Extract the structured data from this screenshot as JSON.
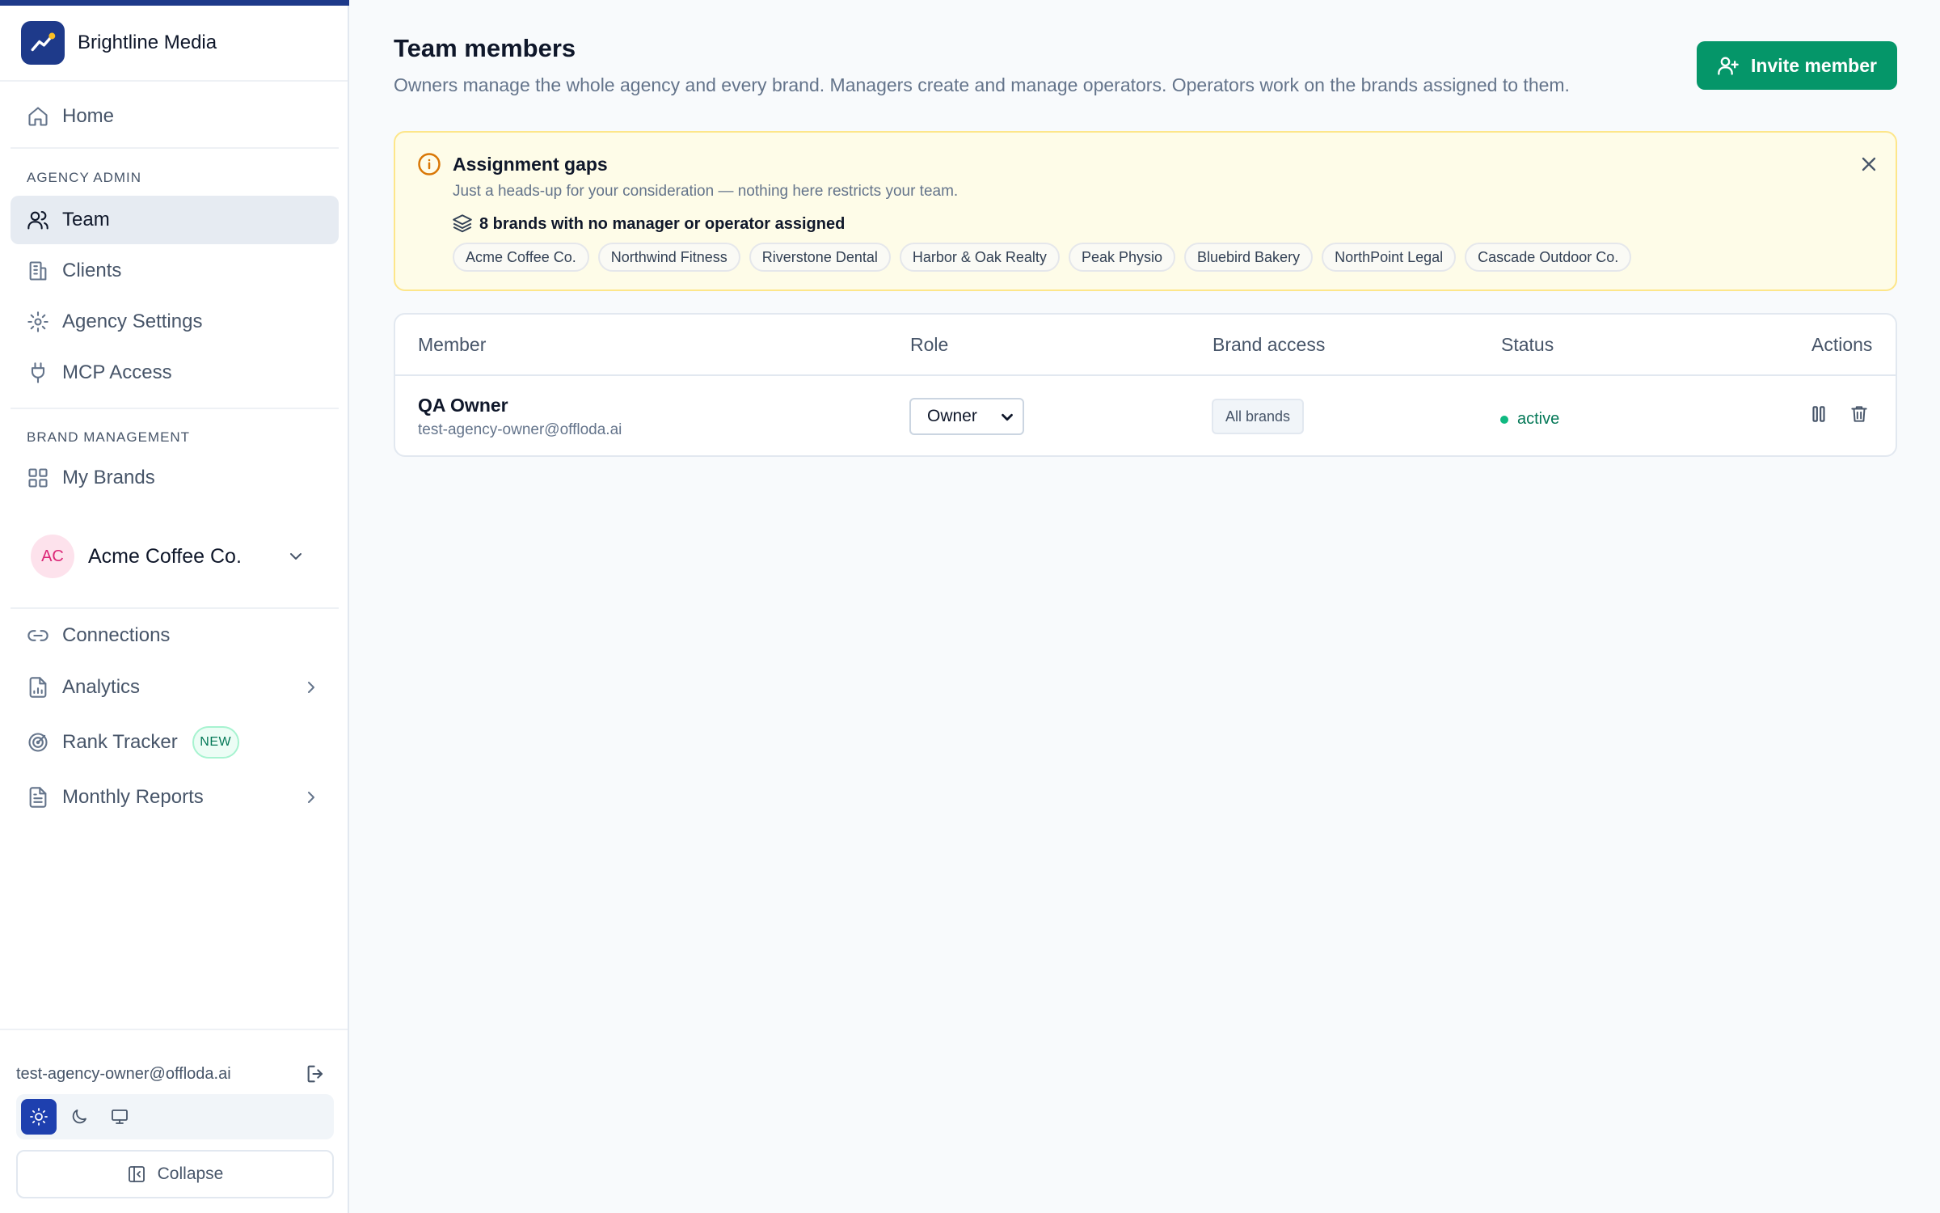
{
  "colors": {
    "brand_navy": "#1e3a8a",
    "accent_green": "#059669",
    "alert_bg": "#fefce8",
    "alert_border": "#fde68a",
    "sidebar_active_bg": "#e6ebf2",
    "status_active": "#10b981"
  },
  "sidebar": {
    "org_name": "Brightline Media",
    "org_logo_icon": "trending-up-icon",
    "home_label": "Home",
    "agency_admin_section": "AGENCY ADMIN",
    "agency_items": [
      {
        "label": "Team",
        "icon": "users-icon",
        "active": true
      },
      {
        "label": "Clients",
        "icon": "building-icon"
      },
      {
        "label": "Agency Settings",
        "icon": "gear-icon"
      },
      {
        "label": "MCP Access",
        "icon": "plug-icon"
      }
    ],
    "brand_section": "BRAND MANAGEMENT",
    "my_brands_label": "My Brands",
    "selected_brand": {
      "initials": "AC",
      "name": "Acme Coffee Co."
    },
    "brand_items": [
      {
        "label": "Connections",
        "icon": "link-icon"
      },
      {
        "label": "Analytics",
        "icon": "file-chart-icon",
        "has_submenu": true
      },
      {
        "label": "Rank Tracker",
        "icon": "radar-icon",
        "badge": "NEW"
      },
      {
        "label": "Monthly Reports",
        "icon": "file-text-icon",
        "has_submenu": true
      }
    ],
    "footer": {
      "user_email": "test-agency-owner@offloda.ai",
      "theme_options": [
        "light",
        "dark",
        "system"
      ],
      "active_theme": "light",
      "collapse_label": "Collapse"
    }
  },
  "main": {
    "title": "Team members",
    "subtitle": "Owners manage the whole agency and every brand. Managers create and manage operators. Operators work on the brands assigned to them.",
    "invite_label": "Invite member",
    "alert": {
      "title": "Assignment gaps",
      "description": "Just a heads-up for your consideration — nothing here restricts your team.",
      "gaps_text": "8 brands with no manager or operator assigned",
      "brands": [
        "Acme Coffee Co.",
        "Northwind Fitness",
        "Riverstone Dental",
        "Harbor & Oak Realty",
        "Peak Physio",
        "Bluebird Bakery",
        "NorthPoint Legal",
        "Cascade Outdoor Co."
      ]
    },
    "table": {
      "columns": {
        "member": "Member",
        "role": "Role",
        "access": "Brand access",
        "status": "Status",
        "actions": "Actions"
      },
      "rows": [
        {
          "name": "QA Owner",
          "email": "test-agency-owner@offloda.ai",
          "role": "Owner",
          "access": "All brands",
          "status": "active"
        }
      ]
    }
  }
}
